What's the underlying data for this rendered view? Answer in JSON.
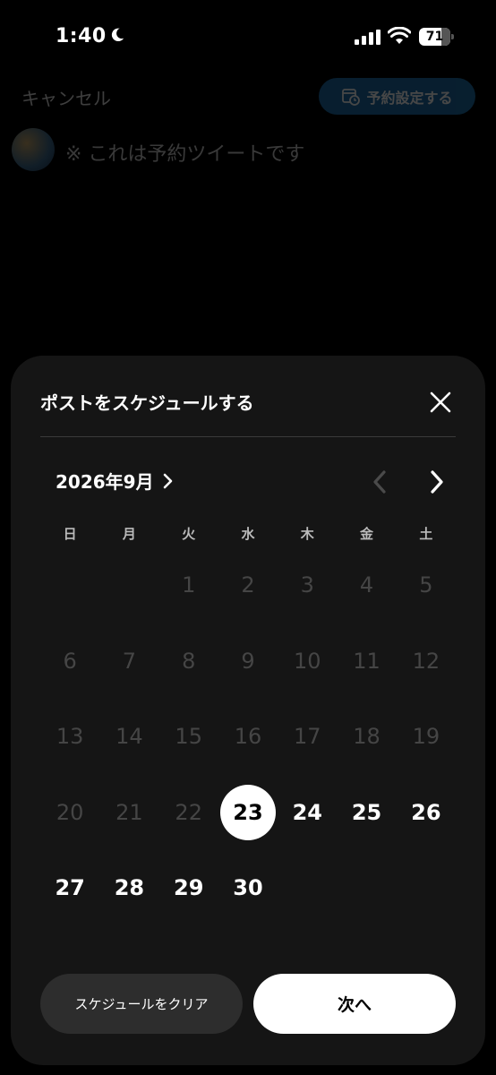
{
  "status_bar": {
    "time": "1:40",
    "battery": "71",
    "battery_level_percent": 71
  },
  "composer": {
    "cancel_label": "キャンセル",
    "schedule_button_label": "予約設定する",
    "tweet_text": "※ これは予約ツイートです"
  },
  "sheet": {
    "title": "ポストをスケジュールする",
    "month_label": "2026年9月",
    "weekdays": [
      "日",
      "月",
      "火",
      "水",
      "木",
      "金",
      "土"
    ],
    "leading_blank_days": 2,
    "days": [
      {
        "label": "1",
        "enabled": false,
        "selected": false
      },
      {
        "label": "2",
        "enabled": false,
        "selected": false
      },
      {
        "label": "3",
        "enabled": false,
        "selected": false
      },
      {
        "label": "4",
        "enabled": false,
        "selected": false
      },
      {
        "label": "5",
        "enabled": false,
        "selected": false
      },
      {
        "label": "6",
        "enabled": false,
        "selected": false
      },
      {
        "label": "7",
        "enabled": false,
        "selected": false
      },
      {
        "label": "8",
        "enabled": false,
        "selected": false
      },
      {
        "label": "9",
        "enabled": false,
        "selected": false
      },
      {
        "label": "10",
        "enabled": false,
        "selected": false
      },
      {
        "label": "11",
        "enabled": false,
        "selected": false
      },
      {
        "label": "12",
        "enabled": false,
        "selected": false
      },
      {
        "label": "13",
        "enabled": false,
        "selected": false
      },
      {
        "label": "14",
        "enabled": false,
        "selected": false
      },
      {
        "label": "15",
        "enabled": false,
        "selected": false
      },
      {
        "label": "16",
        "enabled": false,
        "selected": false
      },
      {
        "label": "17",
        "enabled": false,
        "selected": false
      },
      {
        "label": "18",
        "enabled": false,
        "selected": false
      },
      {
        "label": "19",
        "enabled": false,
        "selected": false
      },
      {
        "label": "20",
        "enabled": false,
        "selected": false
      },
      {
        "label": "21",
        "enabled": false,
        "selected": false
      },
      {
        "label": "22",
        "enabled": false,
        "selected": false
      },
      {
        "label": "23",
        "enabled": true,
        "selected": true
      },
      {
        "label": "24",
        "enabled": true,
        "selected": false
      },
      {
        "label": "25",
        "enabled": true,
        "selected": false
      },
      {
        "label": "26",
        "enabled": true,
        "selected": false
      },
      {
        "label": "27",
        "enabled": true,
        "selected": false
      },
      {
        "label": "28",
        "enabled": true,
        "selected": false
      },
      {
        "label": "29",
        "enabled": true,
        "selected": false
      },
      {
        "label": "30",
        "enabled": true,
        "selected": false
      }
    ],
    "clear_button_label": "スケジュールをクリア",
    "next_button_label": "次へ"
  },
  "colors": {
    "background": "#000000",
    "sheet": "#151515",
    "accent": "#1d6ea8",
    "disabled_day": "#454545"
  },
  "icons": [
    "moon-icon",
    "signal-icon",
    "wifi-icon",
    "battery-icon",
    "calendar-clock-icon",
    "close-icon",
    "chevron-right-icon",
    "chevron-left-icon"
  ]
}
